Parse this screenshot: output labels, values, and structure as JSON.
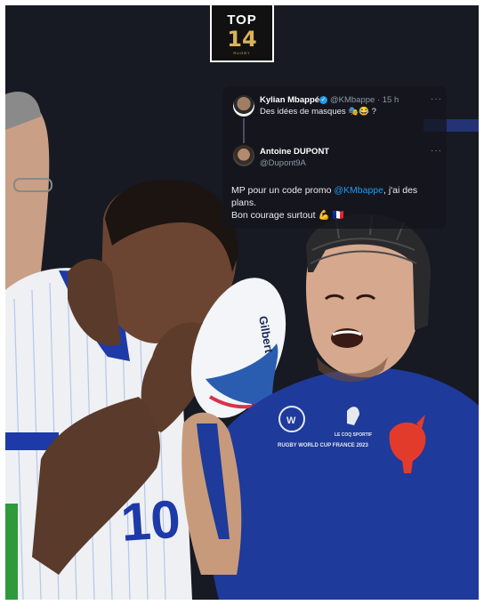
{
  "logo": {
    "line1": "TOP",
    "line2": "14",
    "small": "RUGBY"
  },
  "tweet": {
    "author_name": "Kylian Mbappé",
    "author_handle": "@KMbappe · 15 h",
    "text": "Des idées de masques 🎭😂 ?",
    "more": "···"
  },
  "reply": {
    "author_name": "Antoine DUPONT",
    "author_handle": "@Dupont9A",
    "text_before": "MP pour un code promo ",
    "mention": "@KMbappe",
    "text_after": ", j'ai des plans.",
    "line2": "Bon courage surtout 💪 🇫🇷",
    "more": "···"
  },
  "photo": {
    "jersey_number": "10",
    "badge_text": "RUGBY WORLD CUP FRANCE 2023",
    "crest_text": "LE COQ SPORTIF",
    "ball_text": "Gilbert"
  },
  "colors": {
    "accent": "#1d9bf0",
    "jersey_blue": "#1e3a9a",
    "logo_gold": "#d9b35a"
  }
}
